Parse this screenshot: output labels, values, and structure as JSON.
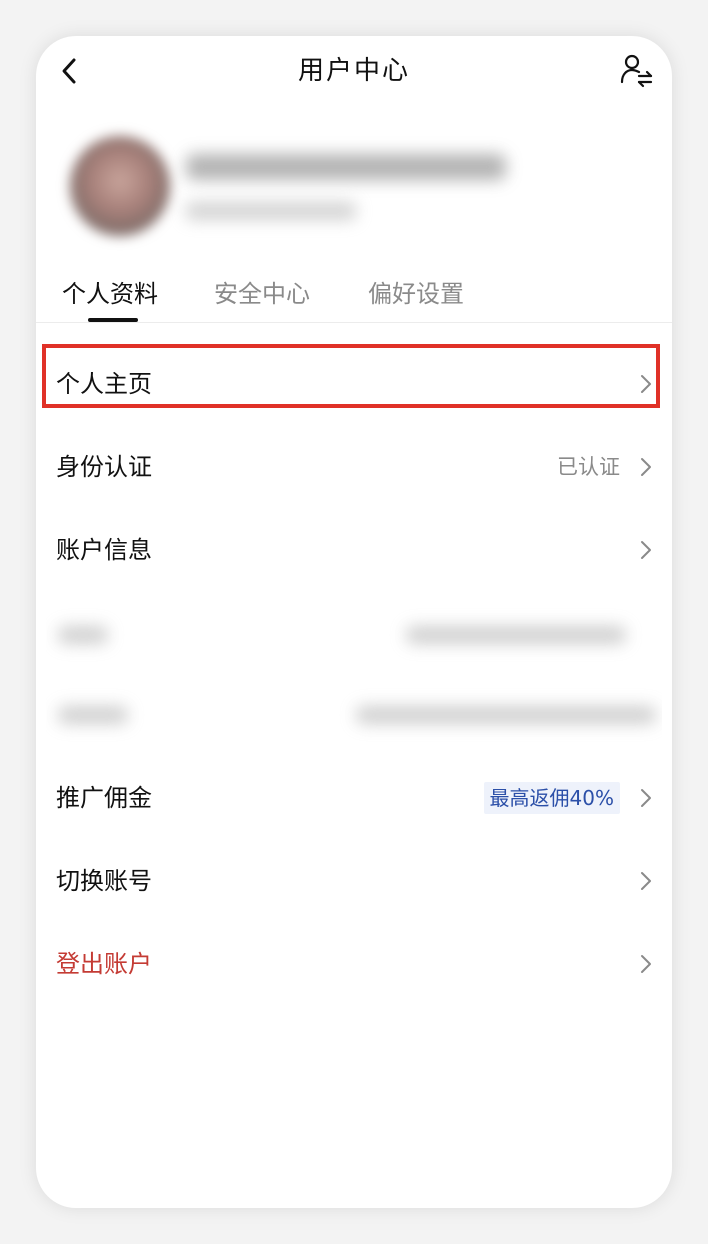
{
  "header": {
    "title": "用户中心",
    "back_icon": "chevron-left-icon",
    "switch_icon": "user-switch-icon"
  },
  "tabs": [
    {
      "label": "个人资料",
      "active": true
    },
    {
      "label": "安全中心",
      "active": false
    },
    {
      "label": "偏好设置",
      "active": false
    }
  ],
  "menu": {
    "personal_homepage": {
      "label": "个人主页"
    },
    "identity_verification": {
      "label": "身份认证",
      "status": "已认证"
    },
    "account_info": {
      "label": "账户信息"
    },
    "referral_commission": {
      "label": "推广佣金",
      "badge": "最高返佣40%"
    },
    "switch_account": {
      "label": "切换账号"
    },
    "logout": {
      "label": "登出账户"
    }
  },
  "colors": {
    "highlight": "#e03127",
    "danger_text": "#c43b34",
    "badge_text": "#2b4fa8",
    "badge_bg": "#eef2fb"
  }
}
